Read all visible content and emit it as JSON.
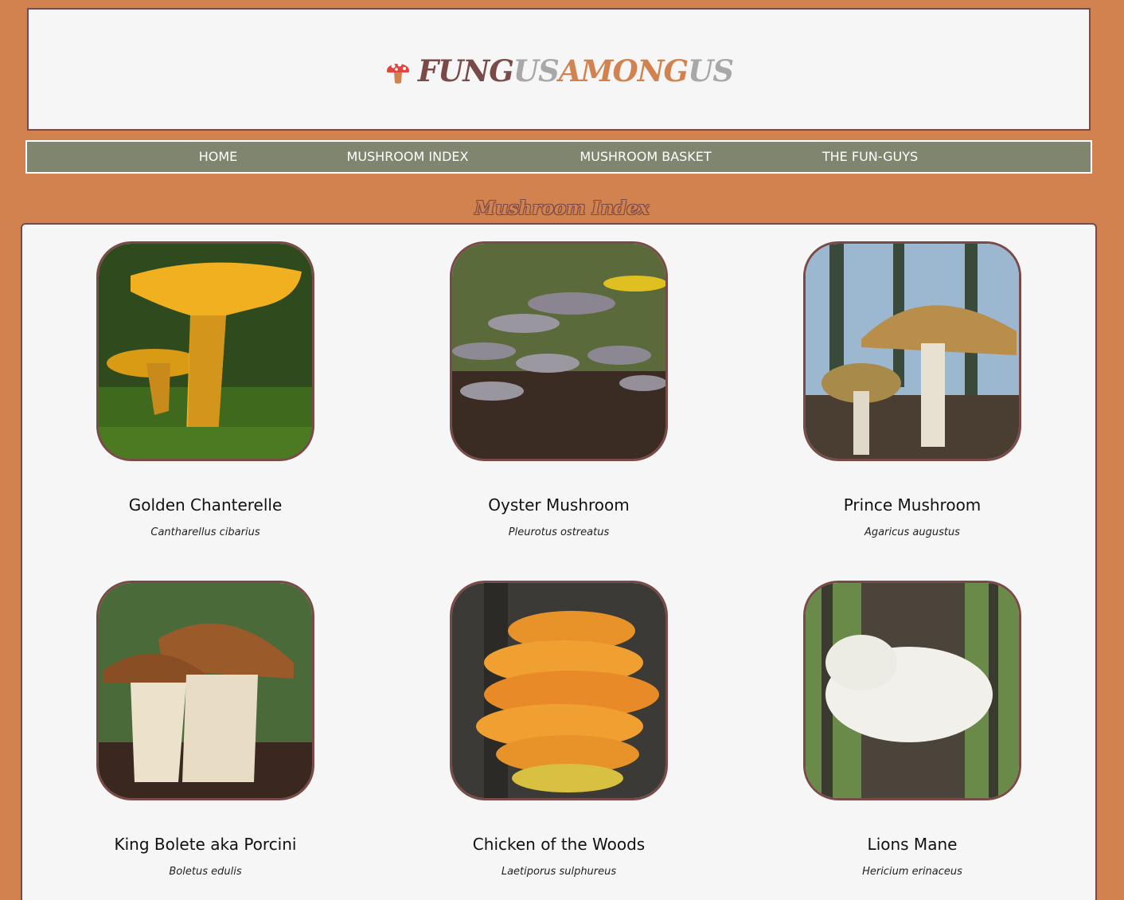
{
  "header": {
    "logo_icon": "mushroom-icon",
    "logo_parts": [
      "FUNG",
      "US",
      "AMONG",
      "US"
    ],
    "colors": {
      "brown": "#7a4a48",
      "grey": "#a8a8a8",
      "orange": "#d2824f"
    }
  },
  "nav": {
    "items": [
      {
        "label": "HOME"
      },
      {
        "label": "MUSHROOM INDEX"
      },
      {
        "label": "MUSHROOM BASKET"
      },
      {
        "label": "THE FUN-GUYS"
      }
    ]
  },
  "main": {
    "title": "Mushroom Index",
    "cards": [
      {
        "name": "Golden Chanterelle",
        "scientific": "Cantharellus cibarius"
      },
      {
        "name": "Oyster Mushroom",
        "scientific": "Pleurotus ostreatus"
      },
      {
        "name": "Prince Mushroom",
        "scientific": "Agaricus augustus"
      },
      {
        "name": "King Bolete aka Porcini",
        "scientific": "Boletus edulis"
      },
      {
        "name": "Chicken of the Woods",
        "scientific": "Laetiporus sulphureus"
      },
      {
        "name": "Lions Mane",
        "scientific": "Hericium erinaceus"
      }
    ]
  },
  "theme": {
    "background": "#d2824f",
    "nav_bg": "#808570",
    "panel_bg": "#f6f6f6",
    "border": "#7a4a48"
  }
}
